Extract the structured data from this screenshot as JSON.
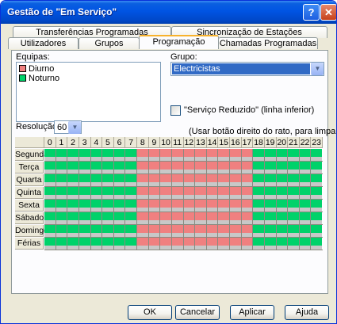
{
  "window": {
    "title": "Gestão de \"Em Serviço\"",
    "help_glyph": "?",
    "close_glyph": "✕"
  },
  "tabs": {
    "row_back": [
      "Transferências Programadas",
      "Sincronização de Estações"
    ],
    "row_front": [
      "Utilizadores",
      "Grupos",
      "Programação",
      "Chamadas Programadas"
    ],
    "active": "Programação"
  },
  "equipas": {
    "label": "Equipas:",
    "items": [
      {
        "name": "Diurno",
        "color": "#f08080"
      },
      {
        "name": "Noturno",
        "color": "#00d26a"
      }
    ]
  },
  "grupo": {
    "label": "Grupo:",
    "value": "Electricistas"
  },
  "reduzido": {
    "label": "\"Serviço Reduzido\" (linha inferior)",
    "checked": false
  },
  "resolucao": {
    "label": "Resolução:",
    "value": "60"
  },
  "hint": "(Usar botão direito do rato, para limpar área)",
  "schedule": {
    "hours": [
      "0",
      "1",
      "2",
      "3",
      "4",
      "5",
      "6",
      "7",
      "8",
      "9",
      "10",
      "11",
      "12",
      "13",
      "14",
      "15",
      "16",
      "17",
      "18",
      "19",
      "20",
      "21",
      "22",
      "23"
    ],
    "days": [
      "Segunda",
      "Terça",
      "Quarta",
      "Quinta",
      "Sexta",
      "Sábado",
      "Domingo",
      "Férias"
    ],
    "diurno_hours": [
      8,
      17
    ],
    "colors": {
      "diurno": "#f08080",
      "noturno": "#00d26a",
      "reduced": "#c8c8c8"
    }
  },
  "buttons": {
    "ok": "OK",
    "cancel": "Cancelar",
    "apply": "Aplicar",
    "help": "Ajuda"
  }
}
